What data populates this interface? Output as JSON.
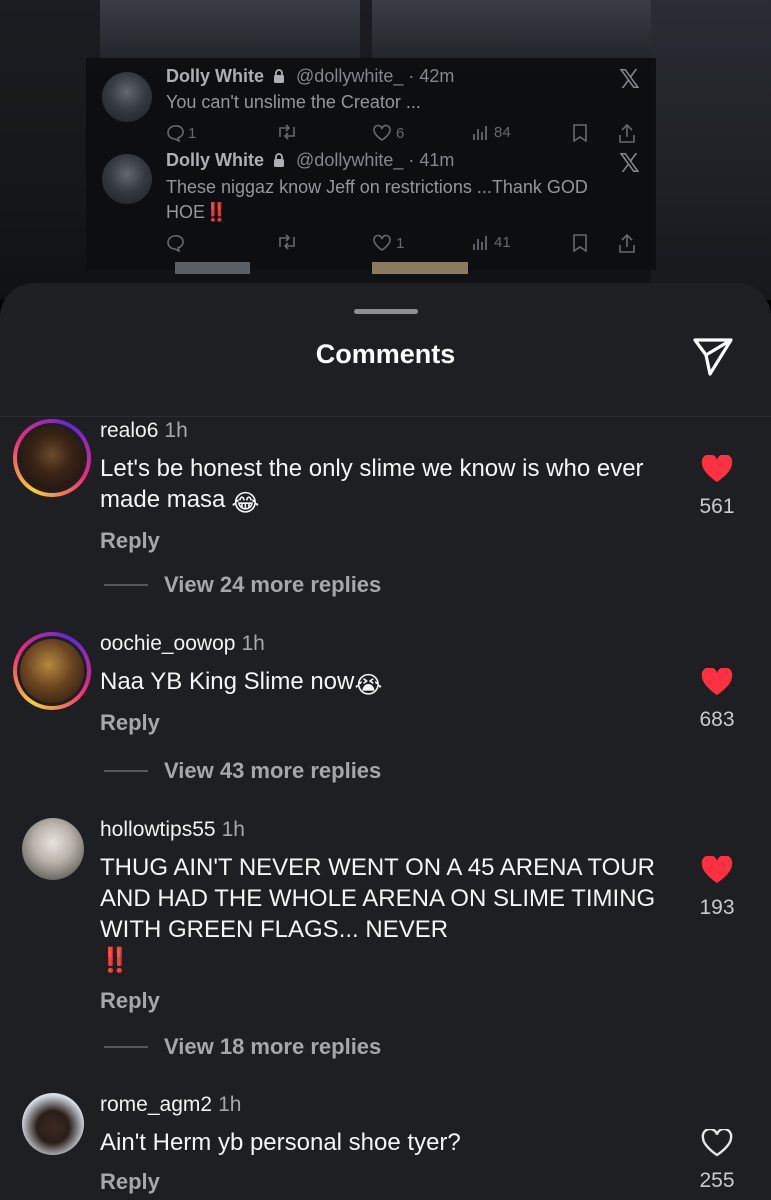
{
  "background_tweets": [
    {
      "name": "Dolly White",
      "handle": "@dollywhite_ · 42m",
      "text": "You can't unslime the Creator ...",
      "replies": "1",
      "likes": "6",
      "views": "84"
    },
    {
      "name": "Dolly White",
      "handle": "@dollywhite_ · 41m",
      "text": "These niggaz know Jeff on restrictions ...Thank GOD HOE",
      "text_emoji": "‼️",
      "replies": "",
      "likes": "1",
      "views": "41"
    }
  ],
  "sheet": {
    "title": "Comments",
    "send_icon": "send-icon"
  },
  "comments": [
    {
      "username": "realo6",
      "time": "1h",
      "text": "Let's be honest the only slime we know is who ever made masa",
      "emoji": "😂",
      "reply_label": "Reply",
      "view_replies": "View 24 more replies",
      "likes": "561",
      "liked": true
    },
    {
      "username": "oochie_oowop",
      "time": "1h",
      "text": "Naa YB King Slime now",
      "emoji": "😭",
      "reply_label": "Reply",
      "view_replies": "View 43 more replies",
      "likes": "683",
      "liked": true
    },
    {
      "username": "hollowtips55",
      "time": "1h",
      "text": "THUG AIN'T NEVER WENT ON A 45 ARENA TOUR AND HAD THE WHOLE ARENA ON SLIME TIMING WITH GREEN FLAGS... NEVER",
      "emoji": "‼️",
      "reply_label": "Reply",
      "view_replies": "View 18 more replies",
      "likes": "193",
      "liked": true
    },
    {
      "username": "rome_agm2",
      "time": "1h",
      "text": "Ain't Herm yb personal shoe tyer?",
      "reply_label": "Reply",
      "likes": "255",
      "liked": false
    }
  ],
  "colors": {
    "sheet_bg": "#1e1f22",
    "like_red": "#ff3040",
    "muted_text": "#a5a7ab"
  }
}
